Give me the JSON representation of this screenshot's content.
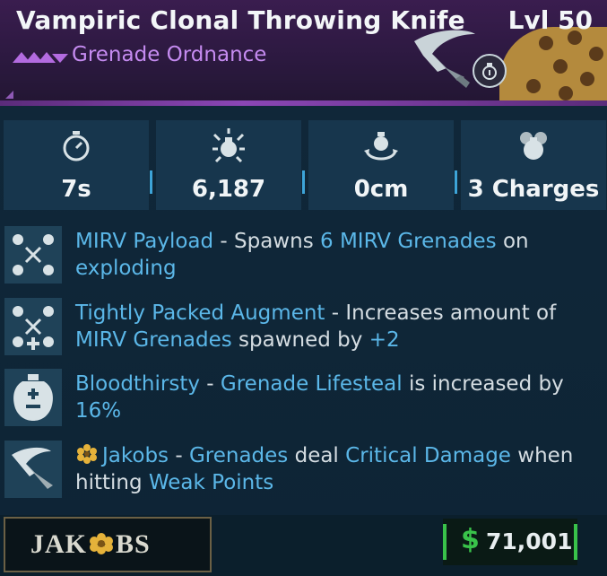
{
  "item": {
    "name": "Vampiric Clonal Throwing Knife",
    "level": "Lvl 50",
    "type": "Grenade Ordnance",
    "rarity_color": "#b36be0",
    "manufacturer": "JAK",
    "manufacturer_suffix": "BS"
  },
  "stats": [
    {
      "icon": "stopwatch-icon",
      "value": "7s"
    },
    {
      "icon": "grenade-explosion-icon",
      "value": "6,187"
    },
    {
      "icon": "grenade-radius-icon",
      "value": "0cm"
    },
    {
      "icon": "grenade-charges-icon",
      "value": "3 Charges"
    }
  ],
  "perks": [
    {
      "icon": "mirv-payload-icon",
      "name": "MIRV Payload",
      "sep": " - ",
      "t1": "Spawns ",
      "h1": "6 MIRV Grenades",
      "t2": " on ",
      "h2": "exploding"
    },
    {
      "icon": "tightly-packed-augment-icon",
      "name": "Tightly Packed Augment",
      "sep": " - ",
      "t1": "Increases amount of ",
      "h1": "MIRV Grenades",
      "t2": " spawned by ",
      "h2": "+2"
    },
    {
      "icon": "bloodthirsty-icon",
      "name": "Bloodthirsty",
      "sep": " - ",
      "h1": "Grenade Lifesteal",
      "t1": " is increased by ",
      "h2": "16%"
    },
    {
      "icon": "knife-icon",
      "name": "Jakobs",
      "sep": " - ",
      "h1": "Grenades",
      "t1": " deal ",
      "h2": "Critical Damage",
      "t2": " when hitting ",
      "h3": "Weak Points"
    }
  ],
  "price": {
    "currency_symbol": "$",
    "amount": "71,001"
  },
  "colors": {
    "highlight": "#5bb7e8",
    "header": "#2c1940",
    "price_green": "#39c24a"
  }
}
